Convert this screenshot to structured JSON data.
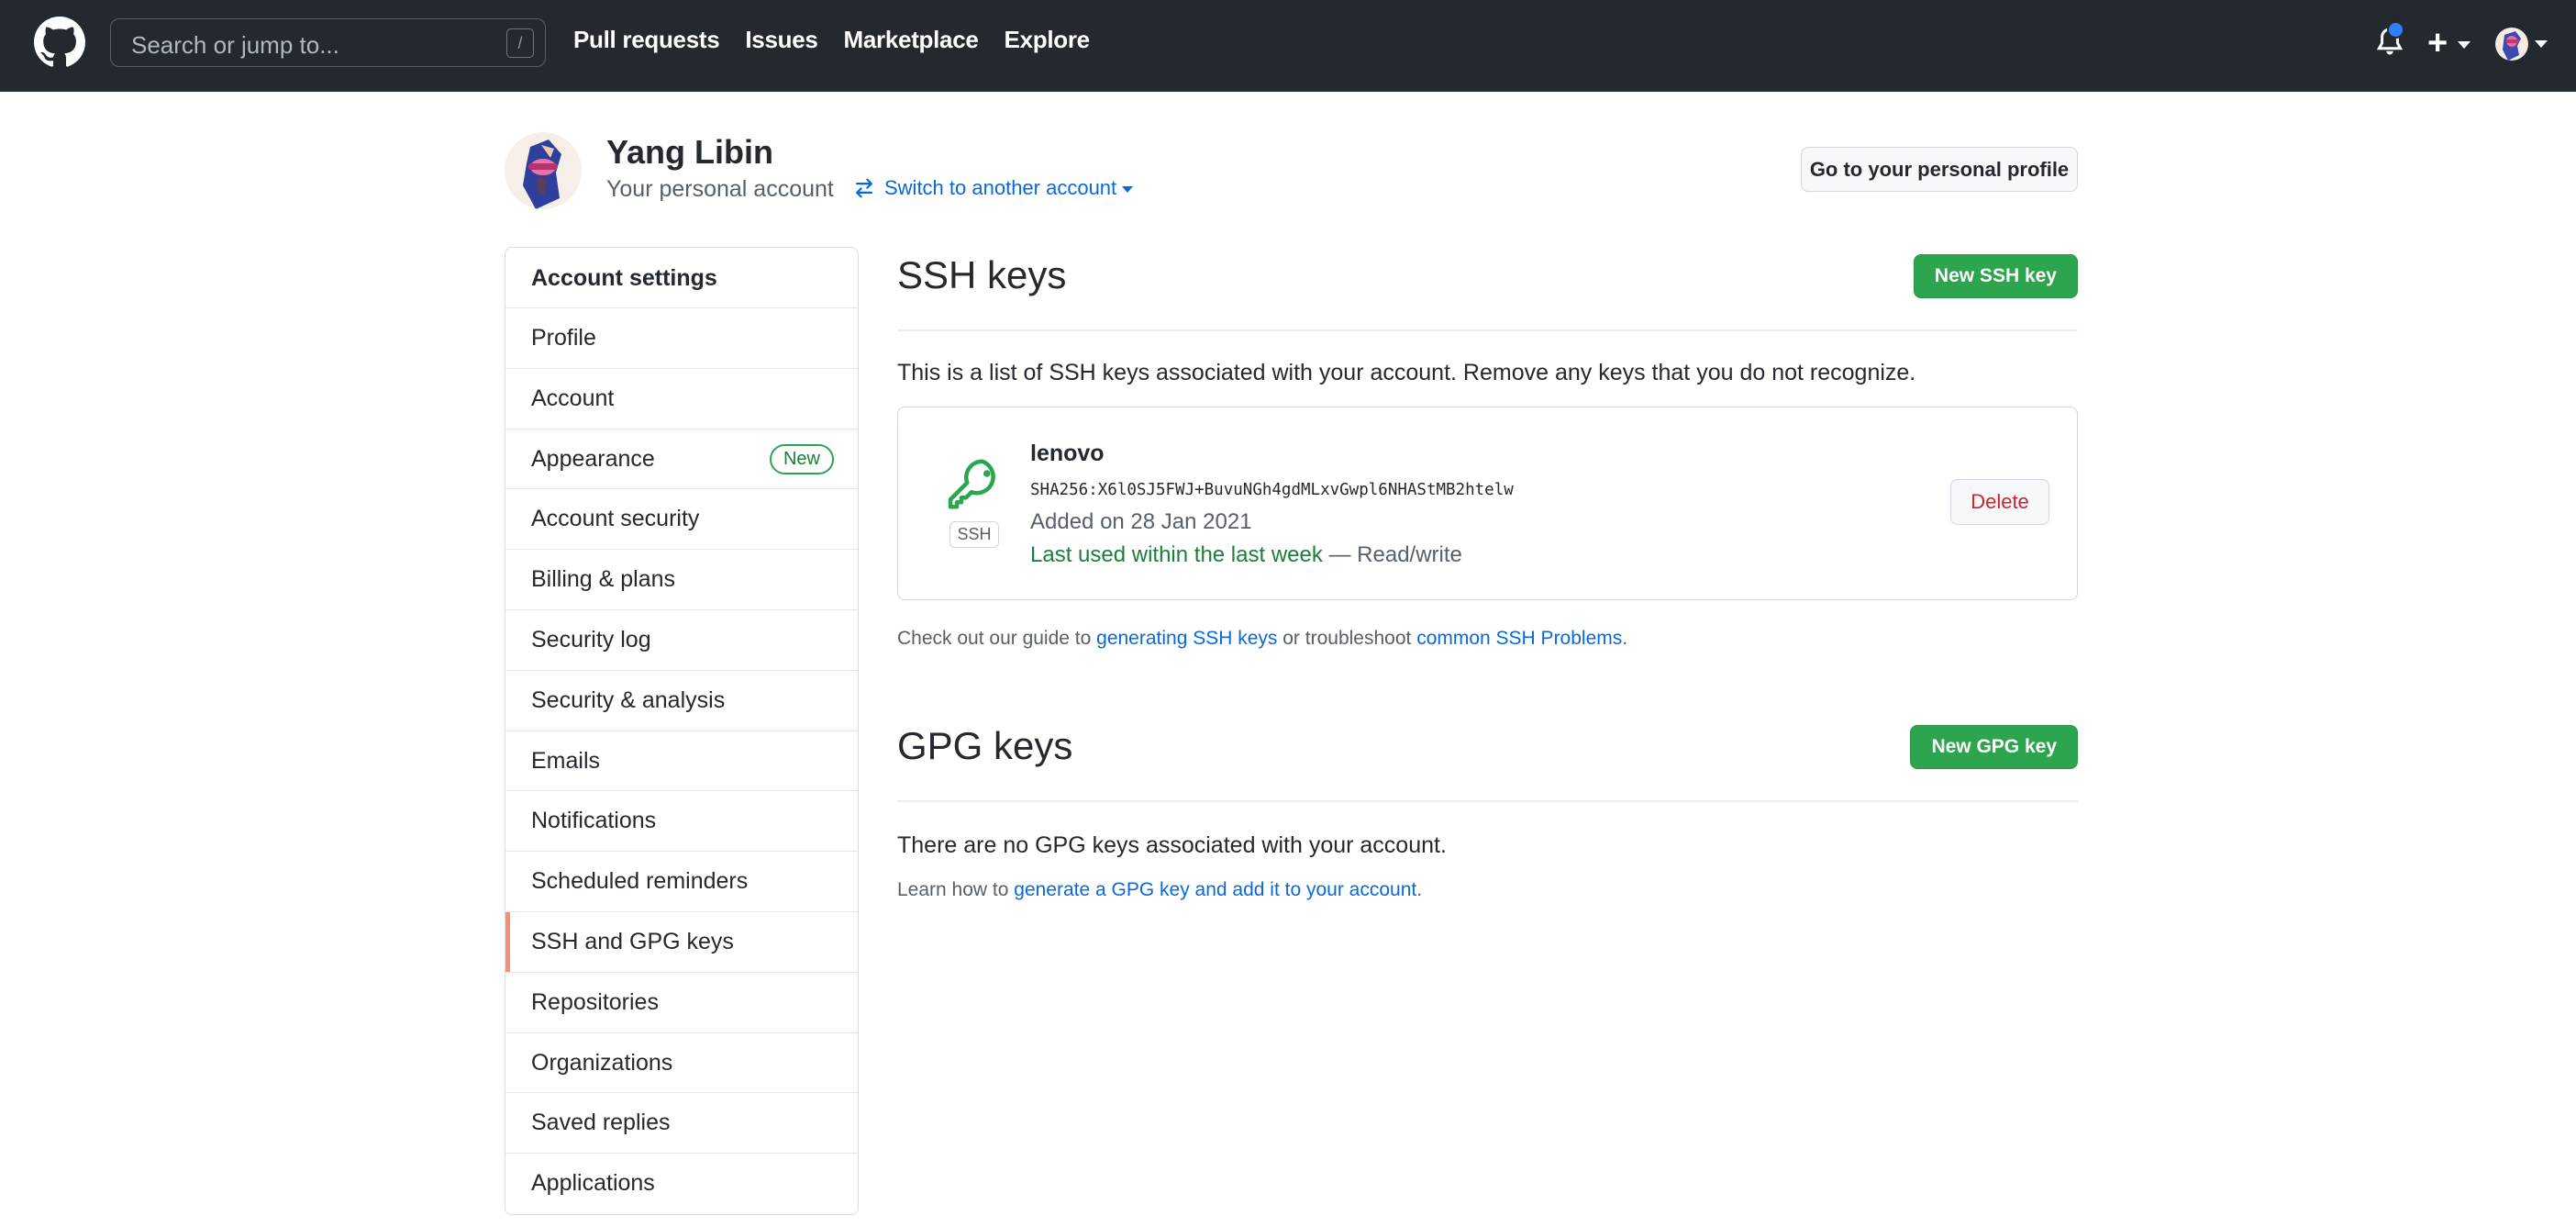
{
  "header": {
    "search_placeholder": "Search or jump to...",
    "search_shortcut": "/",
    "nav": [
      "Pull requests",
      "Issues",
      "Marketplace",
      "Explore"
    ],
    "icons": [
      "github-logo-icon",
      "bell-icon",
      "plus-icon",
      "avatar"
    ],
    "notification_dot_color": "#2f81f7"
  },
  "profile": {
    "name": "Yang Libin",
    "subtitle": "Your personal account",
    "switch_label": "Switch to another account",
    "go_to_profile": "Go to your personal profile"
  },
  "sidebar": {
    "heading": "Account settings",
    "items": [
      {
        "label": "Profile"
      },
      {
        "label": "Account"
      },
      {
        "label": "Appearance",
        "badge": "New"
      },
      {
        "label": "Account security"
      },
      {
        "label": "Billing & plans"
      },
      {
        "label": "Security log"
      },
      {
        "label": "Security & analysis"
      },
      {
        "label": "Emails"
      },
      {
        "label": "Notifications"
      },
      {
        "label": "Scheduled reminders"
      },
      {
        "label": "SSH and GPG keys",
        "active": true
      },
      {
        "label": "Repositories"
      },
      {
        "label": "Organizations"
      },
      {
        "label": "Saved replies"
      },
      {
        "label": "Applications"
      }
    ],
    "active_color": "#fd8c73"
  },
  "ssh": {
    "title": "SSH keys",
    "new_button": "New SSH key",
    "description": "This is a list of SSH keys associated with your account. Remove any keys that you do not recognize.",
    "keys": [
      {
        "title": "lenovo",
        "type_label": "SSH",
        "fingerprint": "SHA256:X6l0SJ5FWJ+BuvuNGh4gdMLxvGwpl6NHAStMB2htelw",
        "added": "Added on 28 Jan 2021",
        "last_used": "Last used within the last week",
        "access": " — Read/write",
        "delete_label": "Delete"
      }
    ],
    "guide_prefix": "Check out our guide to ",
    "guide_link1": "generating SSH keys",
    "guide_middle": " or troubleshoot ",
    "guide_link2": "common SSH Problems",
    "guide_suffix": "."
  },
  "gpg": {
    "title": "GPG keys",
    "new_button": "New GPG key",
    "empty_text": "There are no GPG keys associated with your account.",
    "learn_prefix": "Learn how to ",
    "learn_link": "generate a GPG key and add it to your account",
    "learn_suffix": "."
  },
  "colors": {
    "header_bg": "#24292f",
    "primary_green": "#2da44e",
    "link_blue": "#0969da",
    "danger_red": "#cf222e"
  }
}
